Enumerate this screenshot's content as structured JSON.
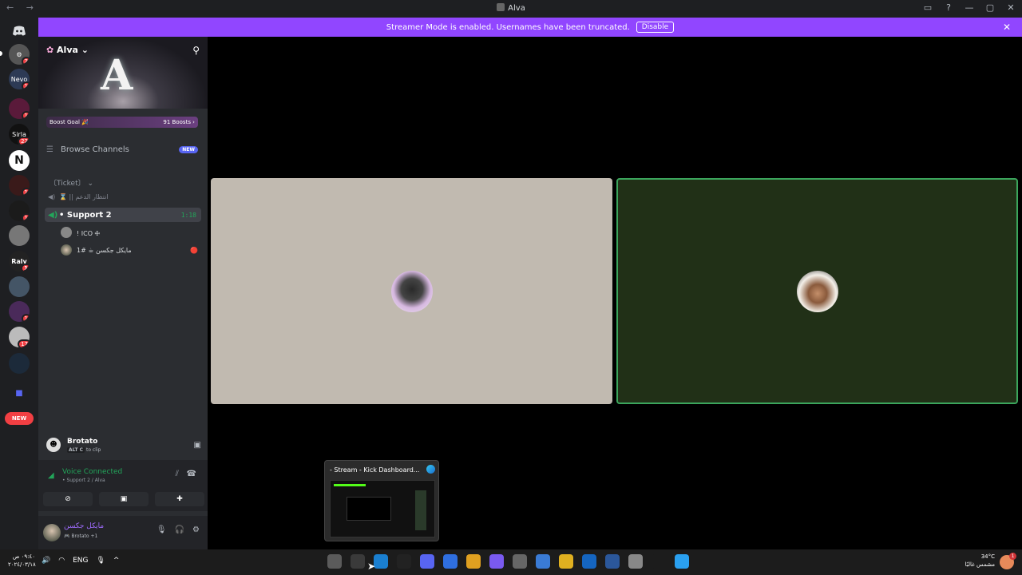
{
  "window": {
    "title": "Alva",
    "nav_icons": "← →",
    "controls": [
      "▭",
      "?",
      "—",
      "▢",
      "✕"
    ]
  },
  "servers": [
    {
      "label": "",
      "icon": "discord-icon",
      "badge": ""
    },
    {
      "label": "⚙",
      "badge": "3"
    },
    {
      "label": "Nevo",
      "badge": "1"
    },
    {
      "label": "",
      "badge": "1"
    },
    {
      "label": "Sirla",
      "badge": "22"
    },
    {
      "label": "N",
      "badge": ""
    },
    {
      "label": "",
      "badge": "1"
    },
    {
      "label": "",
      "badge": "1"
    },
    {
      "label": "",
      "badge": ""
    },
    {
      "label": "Raly",
      "badge": "1"
    },
    {
      "label": "",
      "badge": ""
    },
    {
      "label": "",
      "badge": "1"
    },
    {
      "label": "",
      "badge": "17"
    },
    {
      "label": "",
      "badge": ""
    },
    {
      "label": "",
      "badge": ""
    }
  ],
  "server_new_label": "NEW",
  "banner": {
    "text": "Streamer Mode is enabled. Usernames have been truncated.",
    "button": "Disable"
  },
  "server": {
    "name": "Alva",
    "logo_text": "A",
    "boost_goal": "Boost Goal 🎉",
    "boosts": "91 Boosts ›"
  },
  "browse": {
    "label": "Browse Channels",
    "badge": "NEW"
  },
  "category": "〔Ticket〕 ⌄",
  "channels": [
    {
      "name": "⌛ || انتظار الدعم",
      "time": ""
    },
    {
      "name": "• Support 2",
      "time": "1:18"
    }
  ],
  "voice_users": [
    {
      "name": "! ICO 🜊",
      "status": ""
    },
    {
      "name": "مايكل جكسن ☕ #1",
      "status": "🔴"
    }
  ],
  "activity": {
    "game": "Brotato",
    "hint_keys": "ALT C",
    "hint": "to clip"
  },
  "voice": {
    "status": "Voice Connected",
    "location": "• Support 2 / Alva"
  },
  "user_panel": {
    "name": "مايكل جكسن",
    "status": "🎮 Brotato +1"
  },
  "preview": {
    "title": "- Stream - Kick Dashboard..."
  },
  "taskbar": {
    "time": "٠٩:٤٠ ص",
    "date": "٢٠٢٤/٠٣/١٨",
    "lang": "ENG",
    "weather_temp": "34°C",
    "weather_desc": "مشمس غالبًا",
    "notif_count": "1",
    "apps": [
      {
        "name": "brotato-app",
        "color": "#5b5b5b"
      },
      {
        "name": "obs-app",
        "color": "#3a3a3a"
      },
      {
        "name": "edge-app",
        "color": "#1a7fd0"
      },
      {
        "name": "github-app",
        "color": "#222"
      },
      {
        "name": "discord-app",
        "color": "#5865f2"
      },
      {
        "name": "notes-app",
        "color": "#2f6fe0"
      },
      {
        "name": "chrome-app",
        "color": "#e0a020"
      },
      {
        "name": "copilot-app",
        "color": "#7a5af0"
      },
      {
        "name": "settings-app",
        "color": "#666"
      },
      {
        "name": "store-app",
        "color": "#3a7bd5"
      },
      {
        "name": "explorer-app",
        "color": "#e0b020"
      },
      {
        "name": "outlook-app",
        "color": "#1565c0"
      },
      {
        "name": "word-app",
        "color": "#2b579a"
      },
      {
        "name": "taskview-app",
        "color": "#888"
      },
      {
        "name": "search-app",
        "color": "#1c1c1c"
      },
      {
        "name": "start-app",
        "color": "#2aa0f0"
      }
    ]
  }
}
